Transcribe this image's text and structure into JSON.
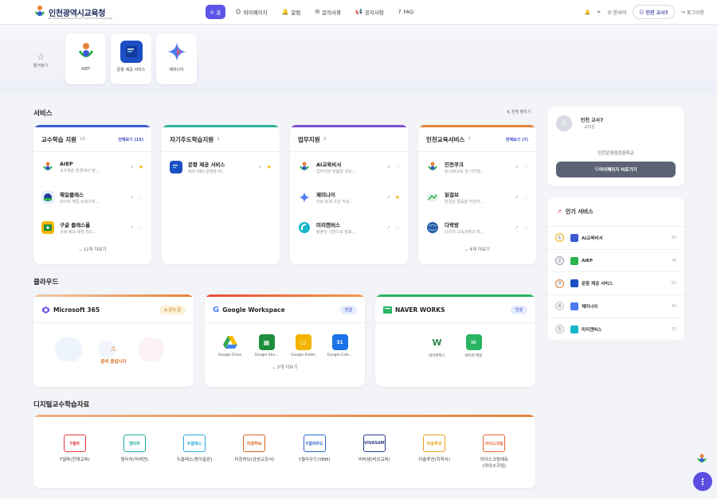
{
  "header": {
    "logo": "인천광역시교육청",
    "logo_sub": "INCHEON METROPOLITAN CITY OFFICE OF EDUCATION",
    "nav": [
      {
        "icon": "⌂",
        "label": "홈"
      },
      {
        "icon": "☺",
        "label": "마이페이지"
      },
      {
        "icon": "🔔",
        "label": "알림"
      },
      {
        "icon": "✉",
        "label": "문의사항"
      },
      {
        "icon": "📢",
        "label": "공지사항"
      },
      {
        "icon": "?",
        "label": "FAQ"
      }
    ],
    "lang": "한국어",
    "user": "인천 교사7",
    "logout": "로그아웃"
  },
  "quick": {
    "fav_label": "즐겨찾기",
    "items": [
      {
        "label": "AIEP"
      },
      {
        "label": "문항 제공 서비스"
      },
      {
        "label": "제미나이"
      }
    ]
  },
  "services": {
    "title": "서비스",
    "view_all": "전체 펼치기",
    "cards": [
      {
        "title": "교수학습 지원",
        "count": "15",
        "more": "전체보기 (15)",
        "color": "#3d5ad4",
        "items": [
          {
            "name": "AIEP",
            "desc": "교수학습 환경에서 발...",
            "star": true
          },
          {
            "name": "해일클래스",
            "desc": "네이버 해일 브레우저...",
            "star": false
          },
          {
            "name": "구글 클래스룸",
            "desc": "과제 배포·채점·피드...",
            "star": false
          }
        ],
        "footer": "12개 더보기"
      },
      {
        "title": "자기주도학습지원",
        "count": "1",
        "more": "",
        "color": "#2bb39a",
        "items": [
          {
            "name": "문항 제공 서비스",
            "desc": "AI와 EBS 문항을 바...",
            "star": true
          }
        ],
        "footer": ""
      },
      {
        "title": "업무지원",
        "count": "3",
        "more": "",
        "color": "#7b4dd6",
        "items": [
          {
            "name": "AI교육비서",
            "desc": "업무지원 맞춤형 생성...",
            "star": false
          },
          {
            "name": "제미나이",
            "desc": "자료 탐색·초안 작성...",
            "star": true
          },
          {
            "name": "미리캔버스",
            "desc": "템플릿 기반으로 발표...",
            "star": false
          }
        ],
        "footer": ""
      },
      {
        "title": "인천교육서비스",
        "count": "7",
        "more": "전체보기 (7)",
        "color": "#e8823a",
        "items": [
          {
            "name": "인천쿠크",
            "desc": "AI·SW교육 및 디지털...",
            "star": false
          },
          {
            "name": "읽걸브",
            "desc": "읽걸은 활동을 지원하...",
            "star": false
          },
          {
            "name": "다락방",
            "desc": "다국어 교육과정과 학...",
            "star": false
          }
        ],
        "footer": "4개 더보기"
      }
    ]
  },
  "cloud": {
    "title": "클라우드",
    "cards": [
      {
        "title": "Microsoft 365",
        "badge": "준비 중",
        "notice": "준비 중입니다",
        "color": "#e8823a",
        "apps": []
      },
      {
        "title": "Google Workspace",
        "badge": "연결",
        "color": "#e94a3b",
        "apps": [
          {
            "label": "Google Drive"
          },
          {
            "label": "Google She..."
          },
          {
            "label": "Google Slides"
          },
          {
            "label": "Google Cale..."
          }
        ],
        "footer": "2개 더보기"
      },
      {
        "title": "NAVER WORKS",
        "badge": "연결",
        "color": "#28b463",
        "apps": [
          {
            "label": "네이버웍스"
          },
          {
            "label": "네이버 메일"
          }
        ]
      }
    ]
  },
  "digital": {
    "title": "디지털교수학습자료",
    "items": [
      {
        "logo": "T셀파",
        "label": "T셀파(천재교육)",
        "color": "#e23b3b"
      },
      {
        "logo": "엠티처",
        "label": "엠티처(미래엔)",
        "color": "#1fa99a"
      },
      {
        "logo": "두클래스",
        "label": "두클래스(동아출판)",
        "color": "#27a8e0"
      },
      {
        "logo": "티칭허브",
        "label": "티칭허브(금성교과서)",
        "color": "#d8641a"
      },
      {
        "logo": "Y클라우드",
        "label": "Y클라우드(YBM)",
        "color": "#2f6ad0"
      },
      {
        "logo": "VIVASAM",
        "label": "비바샘(비상교육)",
        "color": "#2d3e8c"
      },
      {
        "logo": "티솔루션",
        "label": "티솔루션(지학사)",
        "color": "#e8a21a"
      },
      {
        "logo": "아이스크림",
        "label": "아이스크림에듀\n(아이스크림)",
        "color": "#e8623a"
      }
    ]
  },
  "profile": {
    "avatar": "인",
    "name": "인천 교사7",
    "role": "교직원",
    "school": "인천운영점검중학교",
    "button": "마이페이지 바로가기"
  },
  "popular": {
    "title": "인기 서비스",
    "items": [
      {
        "rank": "1",
        "name": "AI교육비서",
        "count": "93"
      },
      {
        "rank": "2",
        "name": "AIEP",
        "count": "74"
      },
      {
        "rank": "3",
        "name": "문항 제공 서비스",
        "count": "61"
      },
      {
        "rank": "4",
        "name": "제미나이",
        "count": "40"
      },
      {
        "rank": "5",
        "name": "미리캔버스",
        "count": "32"
      }
    ]
  },
  "colors": {
    "accent": "#5b54e8",
    "star": "#f2b705"
  }
}
